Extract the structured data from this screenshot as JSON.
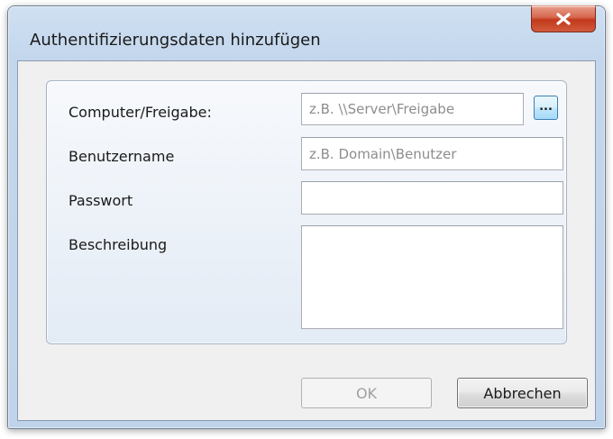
{
  "window": {
    "title": "Authentifizierungsdaten hinzufügen"
  },
  "form": {
    "computer": {
      "label": "Computer/Freigabe:",
      "value": "",
      "placeholder": "z.B. \\\\Server\\Freigabe"
    },
    "browse_label": "...",
    "username": {
      "label": "Benutzername",
      "value": "",
      "placeholder": "z.B. Domain\\Benutzer"
    },
    "password": {
      "label": "Passwort",
      "value": ""
    },
    "description": {
      "label": "Beschreibung",
      "value": ""
    }
  },
  "buttons": {
    "ok_label": "OK",
    "ok_enabled": false,
    "cancel_label": "Abbrechen"
  },
  "colors": {
    "close_button": "#c2391b",
    "disabled_text": "#a0a0a0"
  }
}
